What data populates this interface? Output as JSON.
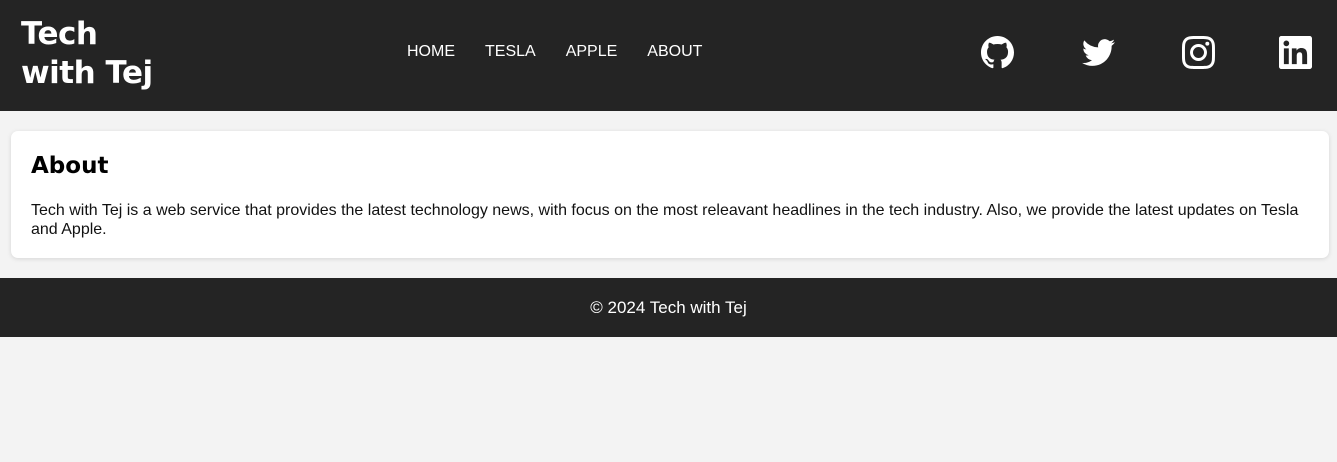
{
  "header": {
    "brand_line1": "Tech",
    "brand_line2": "with Tej",
    "nav": [
      {
        "label": "HOME"
      },
      {
        "label": "TESLA"
      },
      {
        "label": "APPLE"
      },
      {
        "label": "ABOUT"
      }
    ],
    "social_icons": [
      "github-icon",
      "twitter-icon",
      "instagram-icon",
      "linkedin-icon"
    ]
  },
  "main": {
    "heading": "About",
    "body": "Tech with Tej is a web service that provides the latest technology news, with focus on the most releavant headlines in the tech industry. Also, we provide the latest updates on Tesla and Apple."
  },
  "footer": {
    "text": "© 2024 Tech with Tej"
  },
  "colors": {
    "header_bg": "#242424",
    "page_bg": "#f3f3f3",
    "card_bg": "#ffffff",
    "text_light": "#ffffff"
  }
}
